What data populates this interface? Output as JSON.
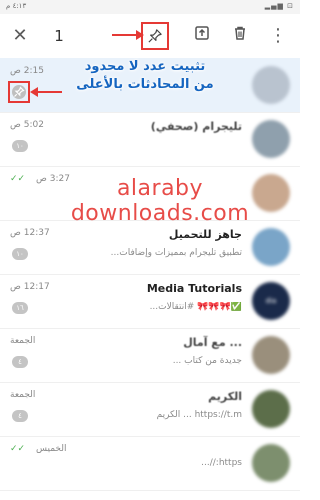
{
  "statusbar": {
    "time": "٤:١٣ م",
    "icons": "▂▄▆ ⊡"
  },
  "toolbar": {
    "close_icon": "✕",
    "selected_count": "1",
    "more_icon": "⋮"
  },
  "callout": {
    "line1": "تثبيت عدد لا محدود",
    "line2": "من المحادثات بالأعلى"
  },
  "watermark": "alaraby downloads.com",
  "chats": [
    {
      "name": "",
      "preview": "",
      "time": "2:15 ص",
      "checks": "",
      "badge": "",
      "pinned": true,
      "avatar_color": "#b9c3cf"
    },
    {
      "name": "تليجرام (صحفي)",
      "preview": "",
      "time": "5:02 ص",
      "checks": "",
      "badge": "١٠",
      "pinned": false,
      "avatar_color": "#8fa0ad"
    },
    {
      "name": "",
      "preview": "",
      "time": "3:27 ص",
      "checks": "✓✓",
      "badge": "",
      "pinned": false,
      "avatar_color": "#c9a88f"
    },
    {
      "name": "جاهز للتحميل",
      "preview": "تطبيق تليجرام بمميزات وإضافات...",
      "time": "12:37 ص",
      "checks": "",
      "badge": "١٠",
      "pinned": false,
      "avatar_color": "#7aa5c8"
    },
    {
      "name": "Media Tutorials",
      "preview": "✅🎀🎀🎀 #انتقالات...",
      "time": "12:17 ص",
      "checks": "",
      "badge": "١٦",
      "pinned": false,
      "avatar_color": "#1a2a4a"
    },
    {
      "name": "... مع آمال",
      "preview": "جديدة من كتاب ...",
      "time": "الجمعة",
      "checks": "",
      "badge": "٤",
      "pinned": false,
      "avatar_color": "#9a8f7c"
    },
    {
      "name": "الكريم",
      "preview": "https://t.m ... الكريم",
      "time": "الجمعة",
      "checks": "",
      "badge": "٤",
      "pinned": false,
      "avatar_color": "#5c6e4a"
    },
    {
      "name": "",
      "preview": "https://...",
      "time": "الخميس",
      "checks": "✓✓",
      "badge": "",
      "pinned": false,
      "avatar_color": "#7d8f6e"
    }
  ],
  "colors": {
    "accent": "#e53935",
    "callout": "#1565c0",
    "selected_row": "#e9f2fb"
  }
}
